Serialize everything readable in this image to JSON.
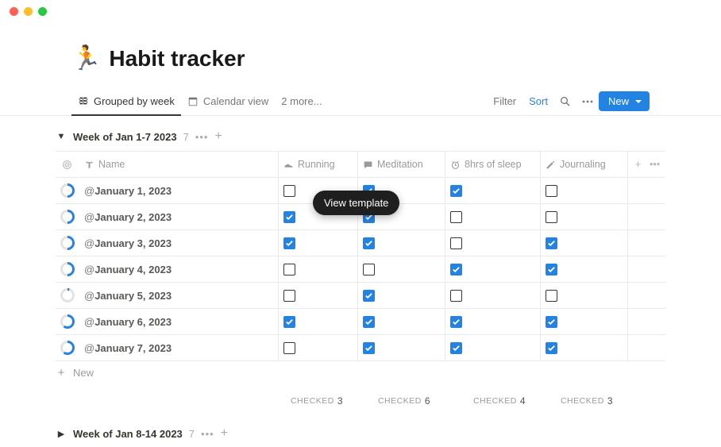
{
  "icon": "🏃",
  "title": "Habit tracker",
  "views": {
    "active": "Grouped by week",
    "second": "Calendar view",
    "more": "2 more..."
  },
  "toolbar": {
    "filter": "Filter",
    "sort": "Sort",
    "new": "New"
  },
  "groups": [
    {
      "name": "Week of Jan 1-7 2023",
      "count": "7",
      "expanded": true
    },
    {
      "name": "Week of Jan 8-14 2023",
      "count": "7",
      "expanded": false
    }
  ],
  "columns": {
    "name": "Name",
    "running": "Running",
    "meditation": "Meditation",
    "sleep": "8hrs of sleep",
    "journaling": "Journaling"
  },
  "rows": [
    {
      "date": "January 1, 2023",
      "progress": 50,
      "running": false,
      "meditation": true,
      "sleep": true,
      "journaling": false
    },
    {
      "date": "January 2, 2023",
      "progress": 50,
      "running": true,
      "meditation": true,
      "sleep": false,
      "journaling": false
    },
    {
      "date": "January 3, 2023",
      "progress": 50,
      "running": true,
      "meditation": true,
      "sleep": false,
      "journaling": true
    },
    {
      "date": "January 4, 2023",
      "progress": 50,
      "running": false,
      "meditation": false,
      "sleep": true,
      "journaling": true
    },
    {
      "date": "January 5, 2023",
      "progress": 5,
      "running": false,
      "meditation": true,
      "sleep": false,
      "journaling": false
    },
    {
      "date": "January 6, 2023",
      "progress": 60,
      "running": true,
      "meditation": true,
      "sleep": true,
      "journaling": true
    },
    {
      "date": "January 7, 2023",
      "progress": 60,
      "running": false,
      "meditation": true,
      "sleep": true,
      "journaling": true
    }
  ],
  "add_row": "New",
  "summary": {
    "label": "CHECKED",
    "running": "3",
    "meditation": "6",
    "sleep": "4",
    "journaling": "3"
  },
  "tooltip": "View template"
}
